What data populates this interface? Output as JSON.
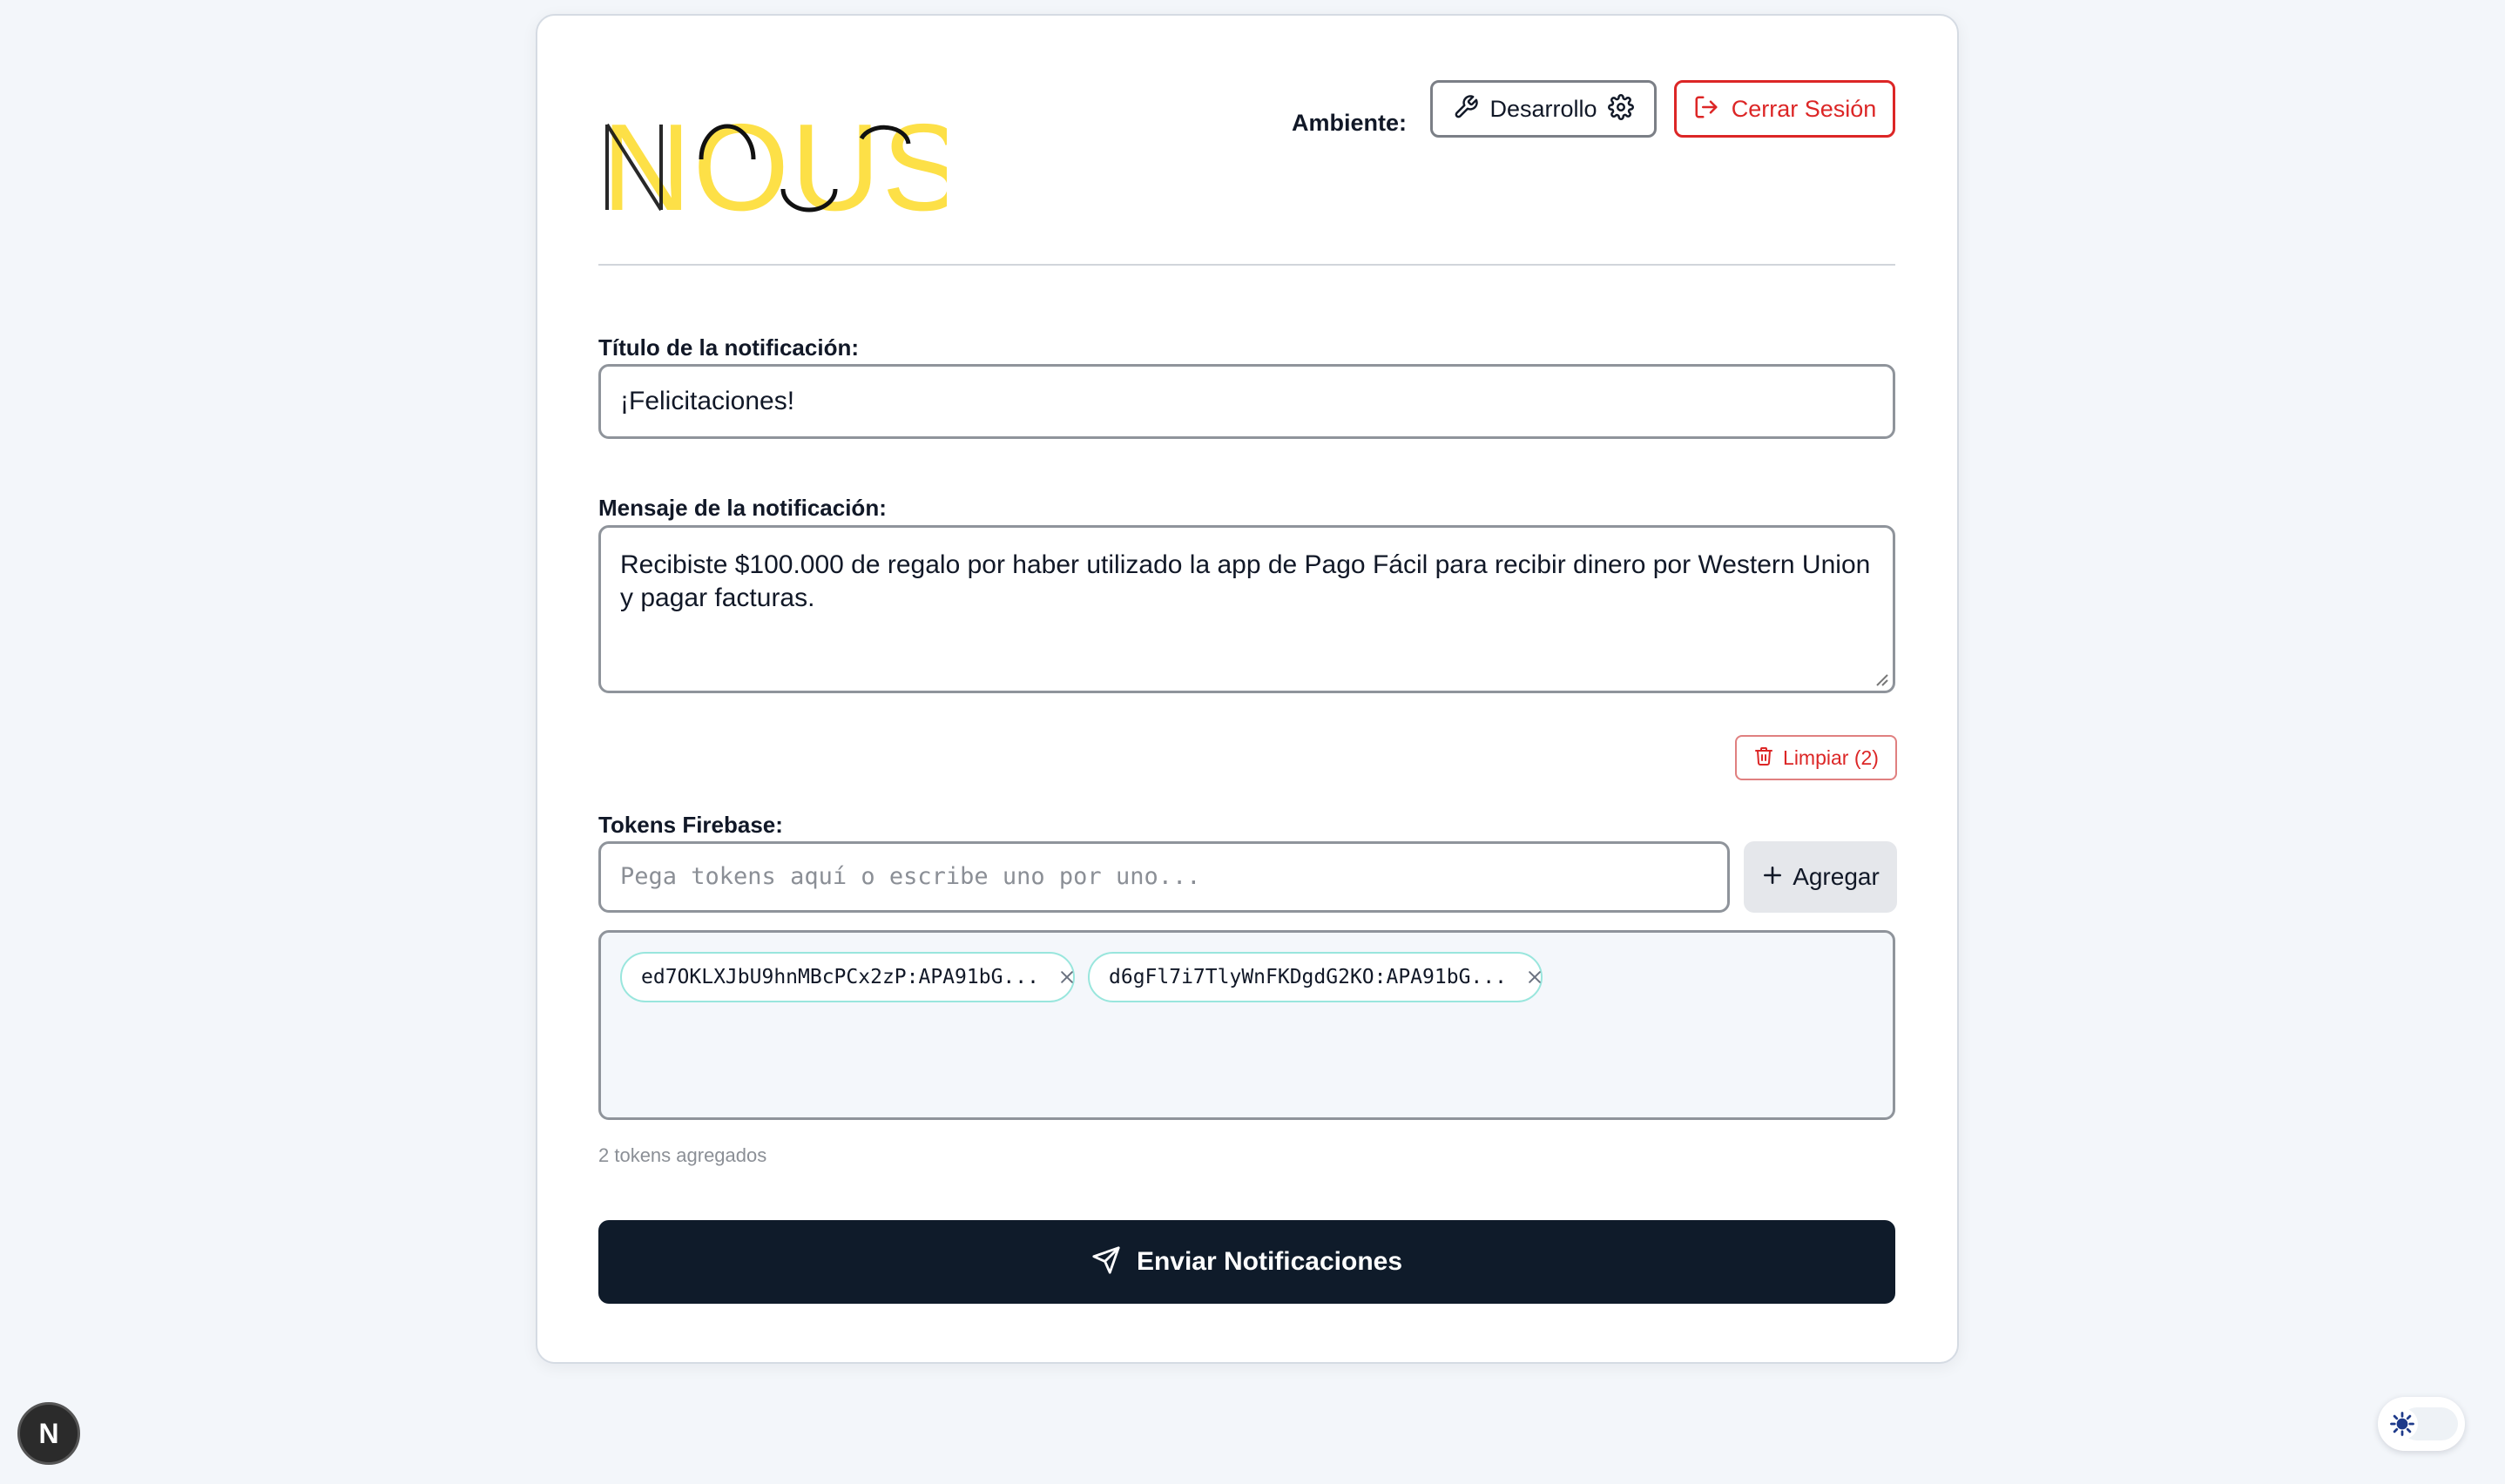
{
  "brand": {
    "logo_text": "NOUS°",
    "colors": {
      "logo_yellow": "#fde047",
      "logo_dark": "#111111"
    }
  },
  "header": {
    "env_label": "Ambiente:",
    "env_button": "Desarrollo",
    "logout_button": "Cerrar Sesión"
  },
  "form": {
    "title_label": "Título de la notificación:",
    "title_value": "¡Felicitaciones!",
    "message_label": "Mensaje de la notificación:",
    "message_value": "Recibiste $100.000 de regalo por haber utilizado la app de Pago Fácil para recibir dinero por Western Union y pagar facturas.",
    "clear_button": "Limpiar (2)",
    "tokens_label": "Tokens Firebase:",
    "tokens_placeholder": "Pega tokens aquí o escribe uno por uno...",
    "add_button": "Agregar",
    "tokens": [
      {
        "label": "ed7OKLXJbU9hnMBcPCx2zP:APA91bG..."
      },
      {
        "label": "d6gFl7i7TlyWnFKDgdG2KO:APA91bG..."
      }
    ],
    "tokens_count": "2 tokens agregados",
    "send_button": "Enviar Notificaciones"
  },
  "overlay": {
    "next_badge": "N"
  },
  "icons": {
    "env_left": "wrench-icon",
    "env_right": "gear-icon",
    "logout": "log-out-icon",
    "clear": "trash-icon",
    "add": "plus-icon",
    "chip_remove": "close-icon",
    "send": "send-icon",
    "theme": "sun-icon"
  },
  "colors": {
    "danger": "#dc2626",
    "primary_button": "#0f1b2a",
    "chip_border": "#99e6dd",
    "page_bg": "#f3f6fa"
  }
}
